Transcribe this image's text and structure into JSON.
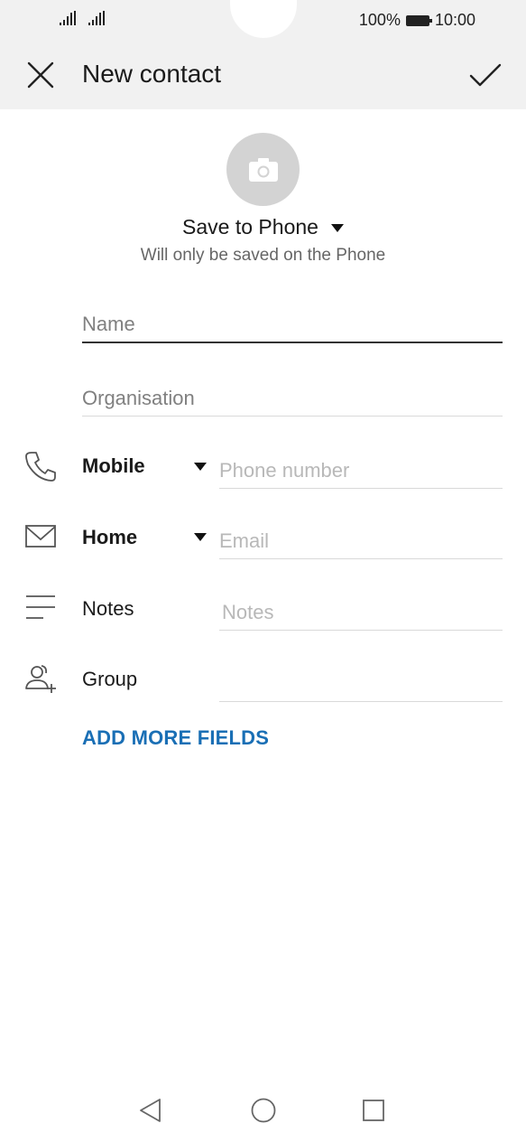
{
  "status_bar": {
    "battery_percent": "100%",
    "time": "10:00"
  },
  "header": {
    "title": "New contact",
    "close_icon": "close-icon",
    "confirm_icon": "check-icon"
  },
  "avatar": {
    "icon": "camera-icon",
    "color": "#d3d3d3"
  },
  "save_location": {
    "label": "Save to Phone",
    "hint": "Will only be saved on the Phone"
  },
  "fields": {
    "name_placeholder": "Name",
    "organisation_placeholder": "Organisation",
    "phone": {
      "type_label": "Mobile",
      "placeholder": "Phone number",
      "icon": "phone-icon"
    },
    "email": {
      "type_label": "Home",
      "placeholder": "Email",
      "icon": "mail-icon"
    },
    "notes": {
      "label": "Notes",
      "placeholder": "Notes",
      "icon": "notes-icon"
    },
    "group": {
      "label": "Group",
      "icon": "add-group-icon"
    }
  },
  "add_more_label": "ADD MORE FIELDS",
  "colors": {
    "accent": "#1a6fb5",
    "header_bg": "#f1f1f1"
  },
  "nav_bar": {
    "back_icon": "back-icon",
    "home_icon": "home-icon",
    "recents_icon": "recents-icon"
  }
}
